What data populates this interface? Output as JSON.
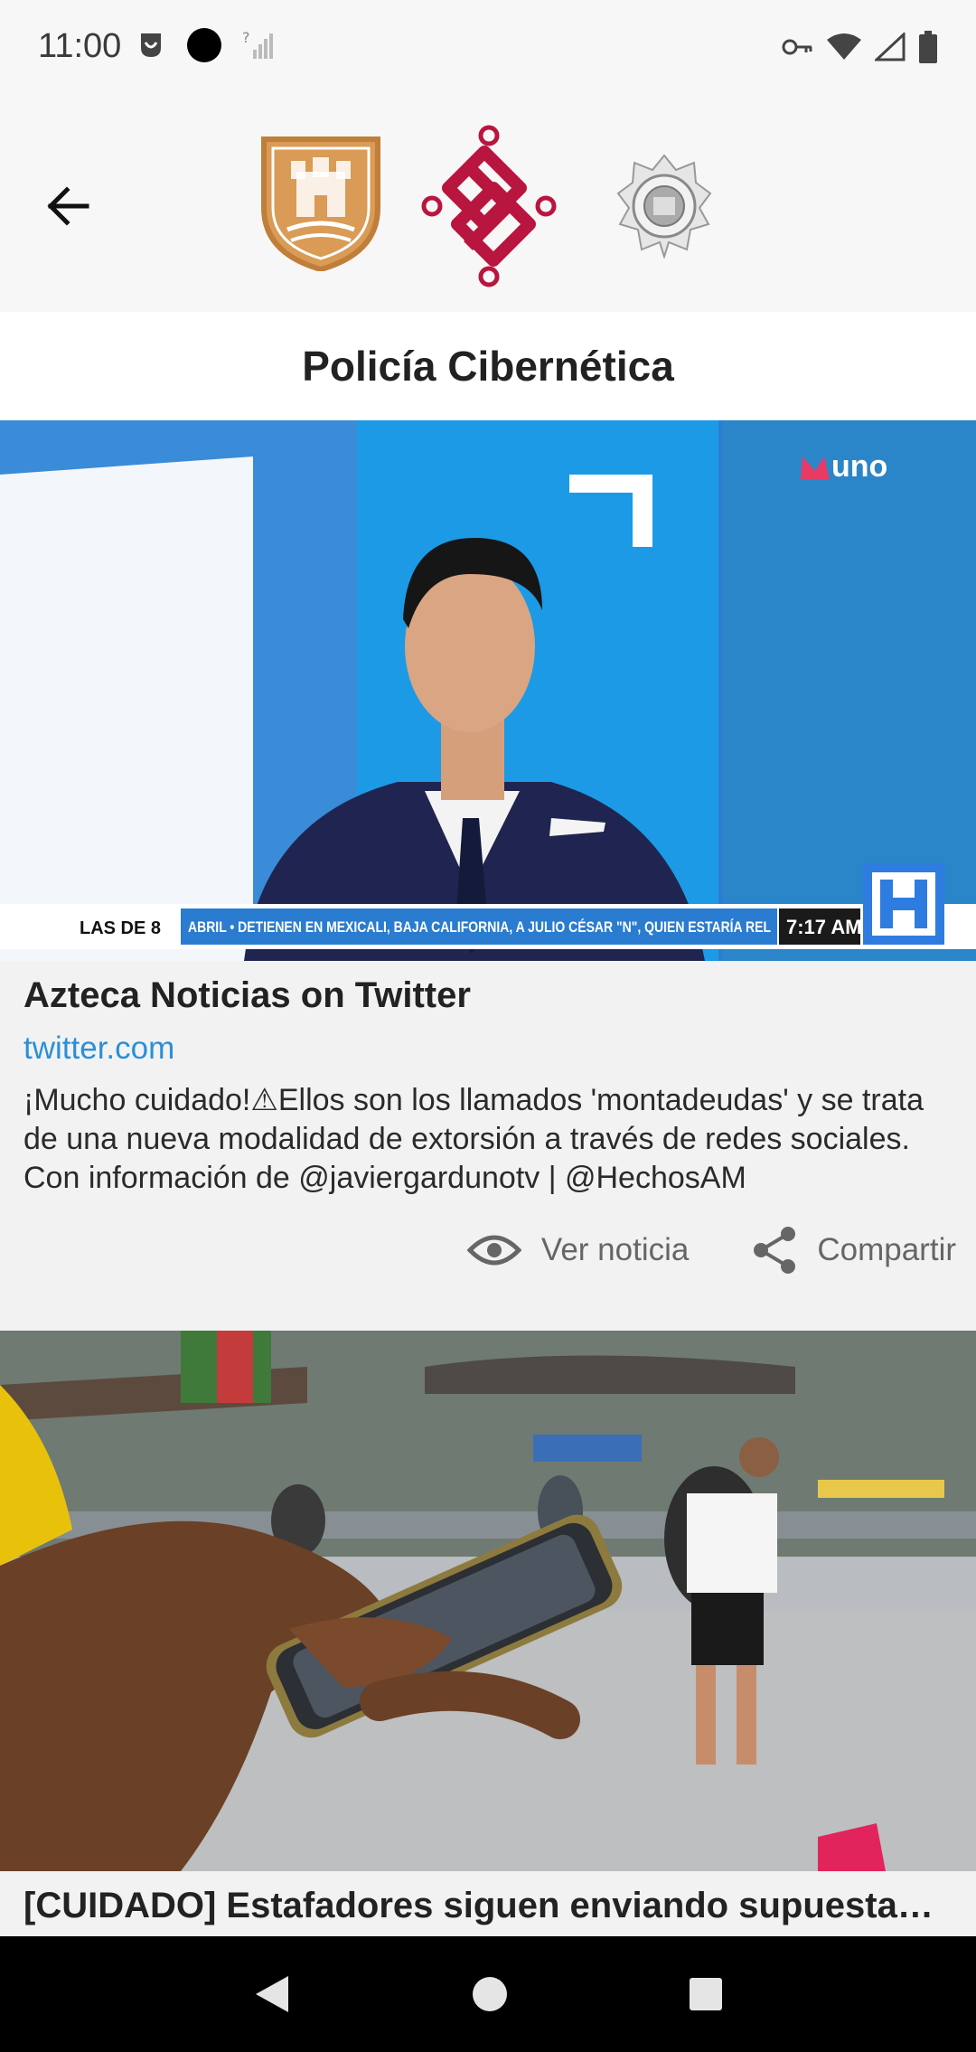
{
  "status_bar": {
    "time": "11:00"
  },
  "header": {
    "back_label": "←",
    "title": "Policía Cibernética"
  },
  "cards": [
    {
      "image_ticker": "ABRIL • DETIENEN EN MEXICALI, BAJA CALIFORNIA, A JULIO CÉSAR \"N\", QUIEN ESTARÍA REL",
      "image_program": "LAS DE 8",
      "image_time": "7:17 AM",
      "image_channel": "uno",
      "title": "Azteca Noticias on Twitter",
      "source": "twitter.com",
      "description": "¡Mucho cuidado!⚠Ellos son los llamados 'montadeudas' y se trata de una nueva modalidad de extorsión a través de redes sociales. Con información de @javiergardunotv | @HechosAM",
      "view_label": "Ver noticia",
      "share_label": "Compartir"
    },
    {
      "title": "[CUIDADO] Estafadores siguen enviando supuestas notificaciones"
    }
  ]
}
